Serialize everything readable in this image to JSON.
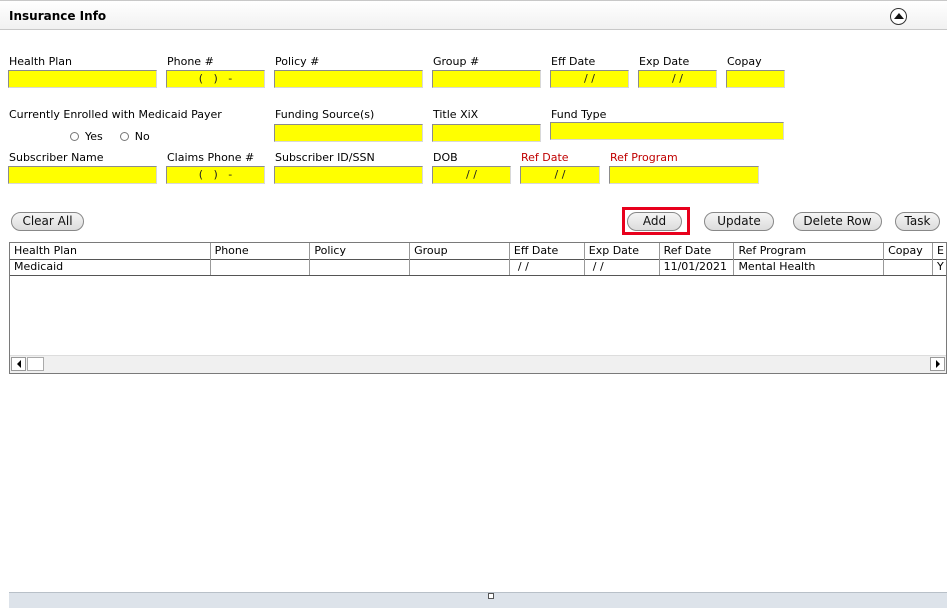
{
  "section": {
    "title": "Insurance Info"
  },
  "labels": {
    "health_plan": "Health Plan",
    "phone": "Phone #",
    "policy": "Policy #",
    "group": "Group #",
    "eff_date": "Eff Date",
    "exp_date": "Exp Date",
    "copay": "Copay",
    "medicaid": "Currently Enrolled with Medicaid Payer",
    "funding": "Funding Source(s)",
    "title_xix": "Title XiX",
    "fund_type": "Fund Type",
    "subscriber_name": "Subscriber Name",
    "claims_phone": "Claims Phone #",
    "subscriber_id": "Subscriber ID/SSN",
    "dob": "DOB",
    "ref_date": "Ref Date",
    "ref_program": "Ref Program"
  },
  "fields": {
    "health_plan": "",
    "phone": "(   )   -",
    "policy": "",
    "group": "",
    "eff_date": "/ /",
    "exp_date": "/ /",
    "copay": "",
    "funding": "",
    "title_xix": "",
    "fund_type": "",
    "subscriber_name": "",
    "claims_phone": "(   )   -",
    "subscriber_id": "",
    "dob": "/ /",
    "ref_date": "/ /",
    "ref_program": ""
  },
  "radios": {
    "yes": "Yes",
    "no": "No"
  },
  "buttons": {
    "clear_all": "Clear All",
    "add": "Add",
    "update": "Update",
    "delete_row": "Delete Row",
    "task": "Task"
  },
  "table": {
    "columns": [
      "Health Plan",
      "Phone",
      "Policy",
      "Group",
      "Eff Date",
      "Exp Date",
      "Ref Date",
      "Ref Program",
      "Copay",
      "E"
    ],
    "rows": [
      [
        "Medicaid",
        "",
        "",
        "",
        " / /",
        " / /",
        "11/01/2021",
        "Mental Health",
        "",
        "Y"
      ]
    ]
  },
  "colors": {
    "field_bg": "#ffff00",
    "required_label": "#c00000",
    "highlight": "#e8001c"
  }
}
